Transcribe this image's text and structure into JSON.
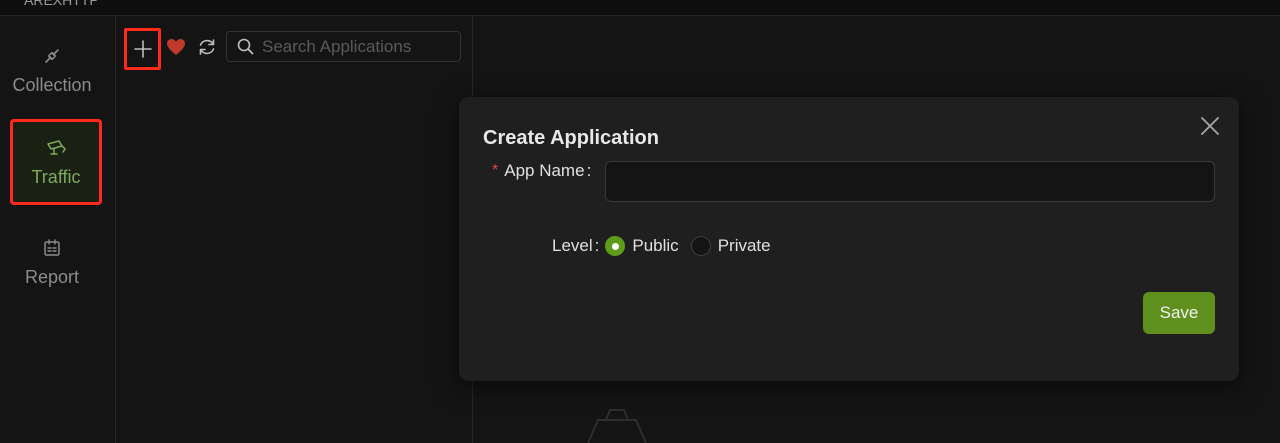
{
  "window": {
    "title": "AREXHTTP"
  },
  "sidebar": {
    "items": [
      {
        "label": "Collection",
        "icon": "collection-icon"
      },
      {
        "label": "Traffic",
        "icon": "traffic-icon",
        "active": true
      },
      {
        "label": "Report",
        "icon": "report-icon"
      }
    ]
  },
  "panel": {
    "toolbar": {
      "add_icon": "plus-icon",
      "favorite_icon": "heart-icon",
      "refresh_icon": "refresh-icon"
    },
    "search": {
      "placeholder": "Search Applications",
      "value": ""
    }
  },
  "modal": {
    "title": "Create Application",
    "app_name": {
      "label": "App Name",
      "required_mark": "*",
      "value": ""
    },
    "level": {
      "label": "Level",
      "options": [
        {
          "label": "Public",
          "checked": true
        },
        {
          "label": "Private",
          "checked": false
        }
      ]
    },
    "save_label": "Save"
  },
  "colors": {
    "accent": "#5f9b1b",
    "highlight": "#ff2a1a",
    "favorite": "#c0392b",
    "background": "#141414",
    "modal_background": "#1f1f1f"
  }
}
